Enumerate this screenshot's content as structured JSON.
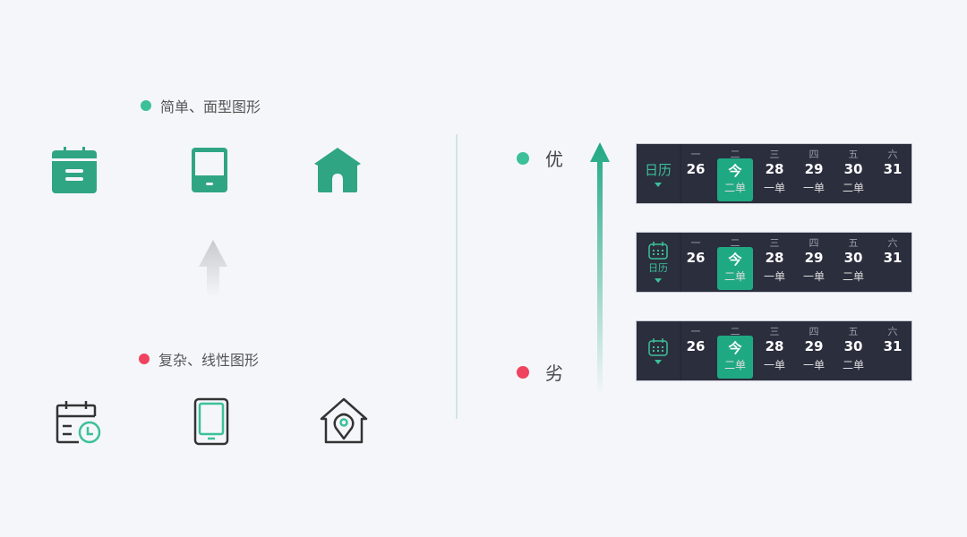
{
  "left": {
    "simple_label": "简单、面型图形",
    "complex_label": "复杂、线性图形",
    "simple_icons": [
      "calendar-filled-icon",
      "tablet-filled-icon",
      "home-filled-icon"
    ],
    "complex_icons": [
      "calendar-clock-outline-icon",
      "tablet-outline-icon",
      "home-location-outline-icon"
    ]
  },
  "right": {
    "better_label": "优",
    "worse_label": "劣",
    "calendar_label": "日历",
    "weekdays": [
      "一",
      "二",
      "三",
      "四",
      "五",
      "六"
    ],
    "days": [
      {
        "num": "26",
        "sub": ""
      },
      {
        "num": "今",
        "sub": "二单",
        "today": true
      },
      {
        "num": "28",
        "sub": "一单"
      },
      {
        "num": "29",
        "sub": "一单"
      },
      {
        "num": "30",
        "sub": "二单"
      },
      {
        "num": "31",
        "sub": ""
      }
    ]
  },
  "colors": {
    "accent": "#2fa584",
    "good": "#3cc09a",
    "bad": "#f0435f",
    "bar": "#2b2e3d",
    "background": "#f5f6fa"
  }
}
